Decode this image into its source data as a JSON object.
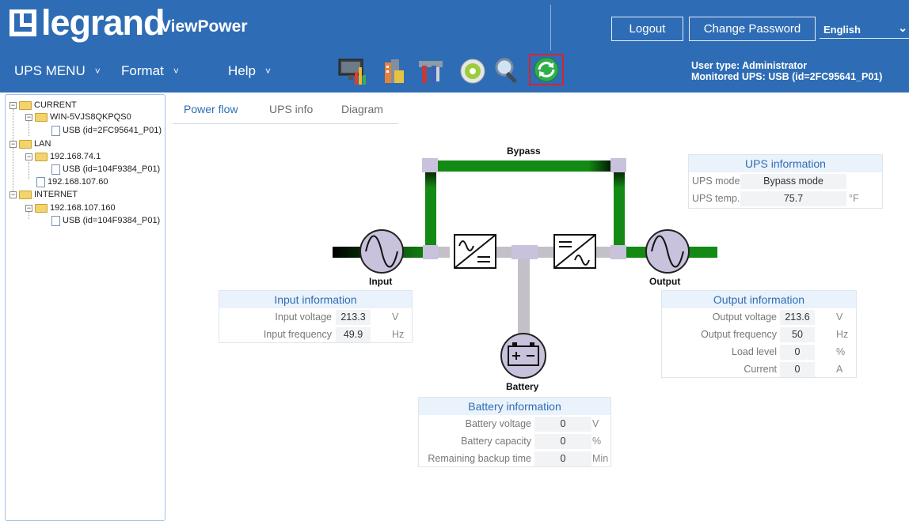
{
  "header": {
    "brand": "legrand",
    "app_name": "ViewPower",
    "logout_label": "Logout",
    "change_password_label": "Change Password",
    "language": "English",
    "user_type": "User type: Administrator",
    "monitored_ups": "Monitored UPS: USB (id=2FC95641_P01)",
    "brand_color": "#2e6db5"
  },
  "menus": [
    {
      "label": "UPS MENU"
    },
    {
      "label": "Format"
    },
    {
      "label": "Help"
    }
  ],
  "toolbar_icons": [
    "monitor-chart-icon",
    "building-config-icon",
    "tools-icon",
    "settings-disc-icon",
    "search-icon",
    "refresh-icon"
  ],
  "tree": {
    "current": "CURRENT",
    "current_host": "WIN-5VJS8QKPQS0",
    "current_device": "USB (id=2FC95641_P01)",
    "lan": "LAN",
    "lan_host1": "192.168.74.1",
    "lan_host1_device": "USB (id=104F9384_P01)",
    "lan_host2": "192.168.107.60",
    "internet": "INTERNET",
    "internet_host": "192.168.107.160",
    "internet_device": "USB (id=104F9384_P01)"
  },
  "tabs": [
    {
      "label": "Power flow",
      "active": true
    },
    {
      "label": "UPS info",
      "active": false
    },
    {
      "label": "Diagram",
      "active": false
    }
  ],
  "flow": {
    "bypass_label": "Bypass",
    "input_label": "Input",
    "output_label": "Output",
    "battery_label": "Battery",
    "active_color": "#138a13",
    "inactive_color": "#c4c0c8"
  },
  "ups_information": {
    "title": "UPS information",
    "mode_label": "UPS mode",
    "mode_value": "Bypass mode",
    "temp_label": "UPS temp.",
    "temp_value": "75.7",
    "temp_unit": "°F"
  },
  "input_information": {
    "title": "Input information",
    "rows": [
      {
        "label": "Input voltage",
        "value": "213.3",
        "unit": "V"
      },
      {
        "label": "Input frequency",
        "value": "49.9",
        "unit": "Hz"
      }
    ]
  },
  "output_information": {
    "title": "Output information",
    "rows": [
      {
        "label": "Output voltage",
        "value": "213.6",
        "unit": "V"
      },
      {
        "label": "Output frequency",
        "value": "50",
        "unit": "Hz"
      },
      {
        "label": "Load level",
        "value": "0",
        "unit": "%"
      },
      {
        "label": "Current",
        "value": "0",
        "unit": "A"
      }
    ]
  },
  "battery_information": {
    "title": "Battery information",
    "rows": [
      {
        "label": "Battery voltage",
        "value": "0",
        "unit": "V"
      },
      {
        "label": "Battery capacity",
        "value": "0",
        "unit": "%"
      },
      {
        "label": "Remaining backup time",
        "value": "0",
        "unit": "Min"
      }
    ]
  }
}
